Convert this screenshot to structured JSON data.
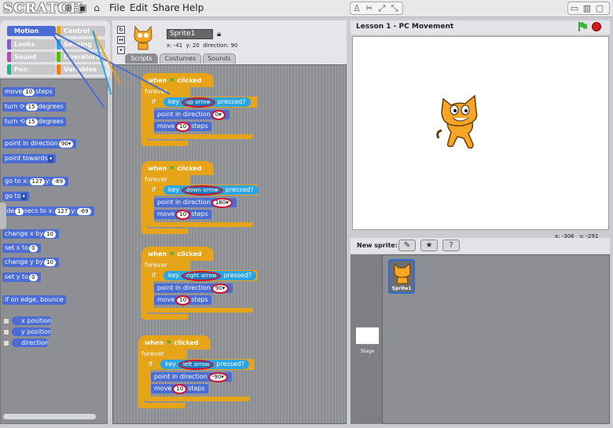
{
  "app": {
    "logo": "SCRATCH"
  },
  "menu": [
    "File",
    "Edit",
    "Share",
    "Help"
  ],
  "categories": [
    {
      "label": "Motion",
      "color": "#4a6cd4",
      "selected": true
    },
    {
      "label": "Control",
      "color": "#e6a418",
      "selected": false
    },
    {
      "label": "Looks",
      "color": "#8a55d7",
      "selected": false
    },
    {
      "label": "Sensing",
      "color": "#2ca5e2",
      "selected": false
    },
    {
      "label": "Sound",
      "color": "#bb42c3",
      "selected": false
    },
    {
      "label": "Operators",
      "color": "#5cb712",
      "selected": false
    },
    {
      "label": "Pen",
      "color": "#0fbd8c",
      "selected": false
    },
    {
      "label": "Variables",
      "color": "#ee7d16",
      "selected": false
    }
  ],
  "palette": {
    "move": {
      "a": "move",
      "v": "10",
      "b": "steps"
    },
    "turn_cw": {
      "a": "turn ⟳",
      "v": "15",
      "b": "degrees"
    },
    "turn_ccw": {
      "a": "turn ⟲",
      "v": "15",
      "b": "degrees"
    },
    "point_dir": {
      "a": "point in direction",
      "v": "90▾"
    },
    "point_towards": {
      "a": "point towards",
      "v": "▾"
    },
    "goto_xy": {
      "a": "go to x:",
      "x": "127",
      "b": "y:",
      "y": "-69"
    },
    "goto": {
      "a": "go to",
      "v": "▾"
    },
    "glide": {
      "a": "ide",
      "v": "1",
      "b": "secs to x:",
      "x": "127",
      "c": "y:",
      "y": "-69"
    },
    "change_x": {
      "a": "change x by",
      "v": "10"
    },
    "set_x": {
      "a": "set x to",
      "v": "0"
    },
    "change_y": {
      "a": "change y by",
      "v": "10"
    },
    "set_y": {
      "a": "set y to",
      "v": "0"
    },
    "bounce": "if on edge, bounce",
    "xpos": "x position",
    "ypos": "y position",
    "direction": "direction"
  },
  "sprite": {
    "name": "Sprite1",
    "x_label": "x: -41",
    "y_label": "y: 20",
    "dir_label": "direction: 90"
  },
  "tabs": [
    "Scripts",
    "Costumes",
    "Sounds"
  ],
  "scripts": [
    {
      "hat": "when",
      "hat_b": "clicked",
      "forever": "forever",
      "if": "if",
      "key": "key",
      "key_val": "up arrow",
      "pressed": "pressed?",
      "point": "point in direction",
      "dir": "0▾",
      "move": "move",
      "steps_v": "10",
      "steps": "steps"
    },
    {
      "hat": "when",
      "hat_b": "clicked",
      "forever": "forever",
      "if": "if",
      "key": "key",
      "key_val": "down arrow",
      "pressed": "pressed?",
      "point": "point in direction",
      "dir": "180▾",
      "move": "move",
      "steps_v": "10",
      "steps": "steps"
    },
    {
      "hat": "when",
      "hat_b": "clicked",
      "forever": "forever",
      "if": "if",
      "key": "key",
      "key_val": "right arrow",
      "pressed": "pressed?",
      "point": "point in direction",
      "dir": "90▾",
      "move": "move",
      "steps_v": "10",
      "steps": "steps"
    },
    {
      "hat": "when",
      "hat_b": "clicked",
      "forever": "forever",
      "if": "if",
      "key": "key",
      "key_val": "left arrow",
      "pressed": "pressed?",
      "point": "point in direction",
      "dir": "-90▾",
      "move": "move",
      "steps_v": "10",
      "steps": "steps"
    }
  ],
  "stage": {
    "title": "Lesson 1 - PC Movement",
    "mouse_x": "x: -306",
    "mouse_y": "y: -291"
  },
  "sprites_panel": {
    "new_sprite": "New sprite:",
    "sprite_label": "Sprite1",
    "stage_label": "Stage"
  },
  "colors": {
    "motion": "#4a6cd4",
    "control": "#e6a418",
    "sensing": "#2ca5e2",
    "highlight": "#d0102a"
  }
}
